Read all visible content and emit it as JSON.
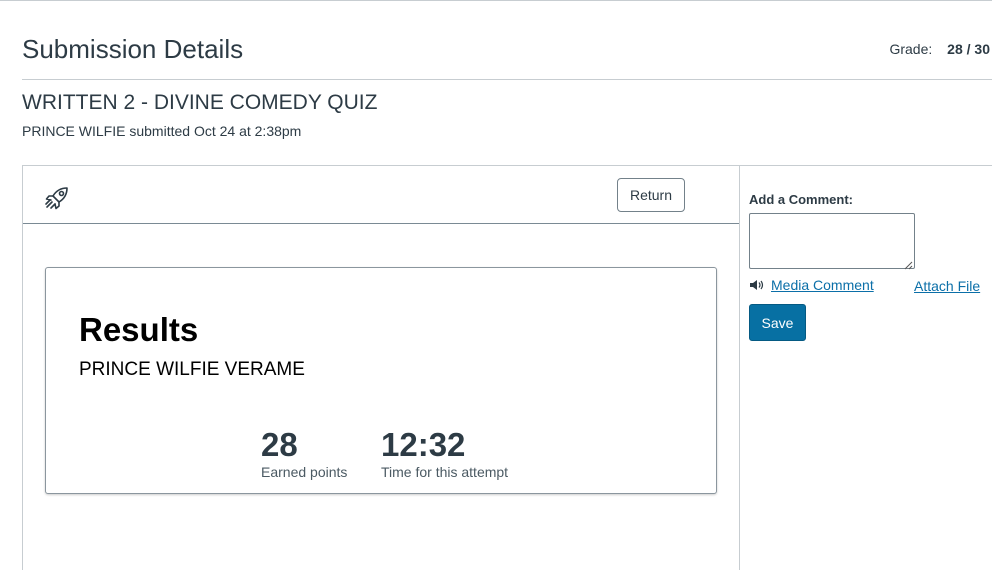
{
  "header": {
    "title": "Submission Details",
    "grade_label": "Grade:",
    "grade_value": "28 / 30"
  },
  "submission": {
    "assignment_title": "WRITTEN 2 - DIVINE COMEDY QUIZ",
    "student": "PRINCE WILFIE",
    "submitted_text": "submitted Oct 24 at 2:38pm"
  },
  "toolbar": {
    "icon": "rocket-icon",
    "return_label": "Return"
  },
  "results": {
    "heading": "Results",
    "student_name": "PRINCE WILFIE VERAME",
    "points_value": "28",
    "points_label": "Earned points",
    "time_value": "12:32",
    "time_label": "Time for this attempt"
  },
  "comments": {
    "label": "Add a Comment:",
    "value": "",
    "media_comment_label": "Media Comment",
    "attach_file_label": "Attach File",
    "save_label": "Save"
  },
  "colors": {
    "text": "#2d3b45",
    "link": "#0b6fa8",
    "primary_button": "#0770a3",
    "border": "#c7cdd1"
  }
}
